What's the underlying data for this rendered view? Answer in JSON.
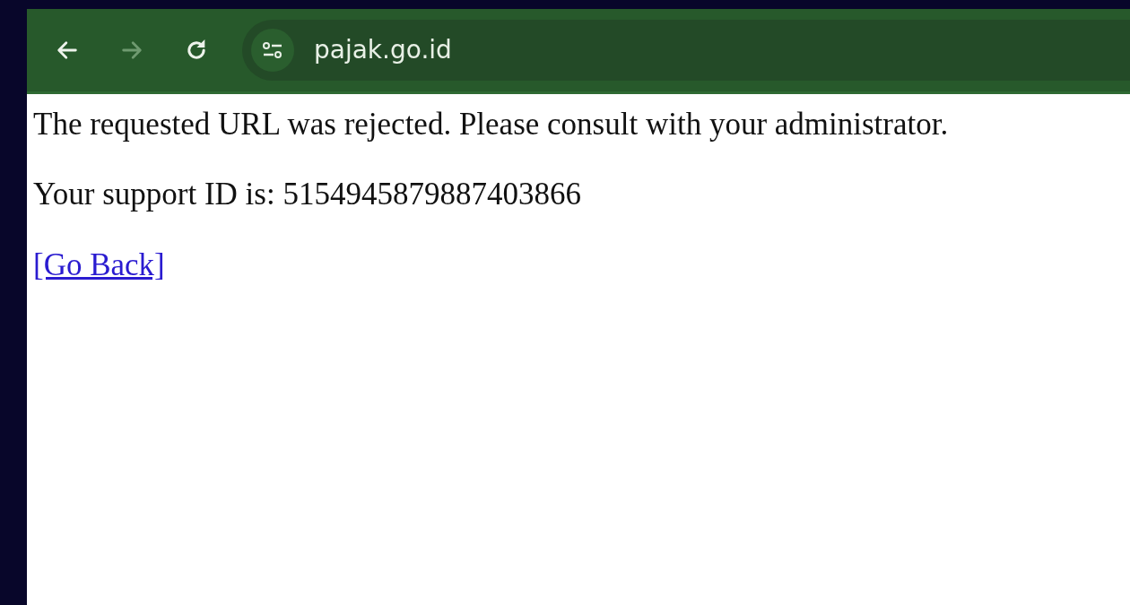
{
  "toolbar": {
    "nav_buttons": [
      {
        "kind": "back",
        "disabled": false
      },
      {
        "kind": "forward",
        "disabled": true
      },
      {
        "kind": "reload",
        "disabled": false
      }
    ],
    "url": "pajak.go.id"
  },
  "page": {
    "message": "The requested URL was rejected. Please consult with your administrator.",
    "support_id": "Your support ID is: 5154945879887403866",
    "link": "[Go Back]"
  }
}
